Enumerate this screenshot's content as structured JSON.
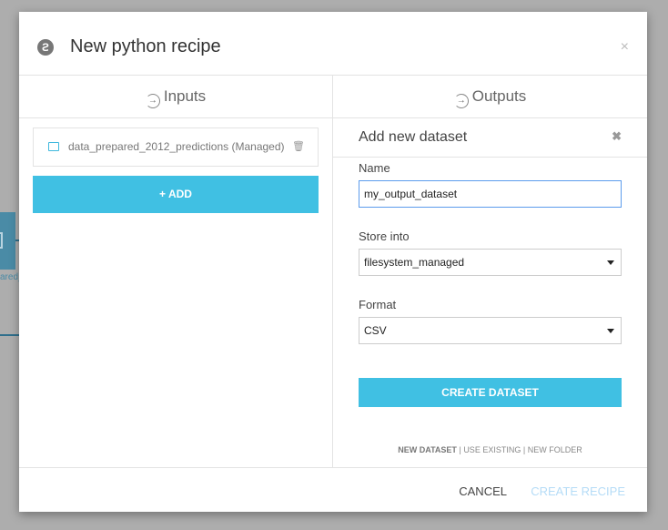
{
  "background": {
    "node_label": "ared_"
  },
  "dialog": {
    "title": "New python recipe",
    "close_icon": "×",
    "inputs": {
      "heading": "Inputs",
      "items": [
        {
          "name": "data_prepared_2012_predictions (Managed)"
        }
      ],
      "add_label": "+ ADD"
    },
    "outputs": {
      "heading": "Outputs",
      "panel_title": "Add new dataset",
      "panel_close": "✖",
      "name_label": "Name",
      "name_value": "my_output_dataset",
      "store_label": "Store into",
      "store_value": "filesystem_managed",
      "format_label": "Format",
      "format_value": "CSV",
      "create_dataset_label": "CREATE DATASET",
      "modes": {
        "new_dataset": "NEW DATASET",
        "sep": "|",
        "use_existing": "USE EXISTING",
        "new_folder": "NEW FOLDER"
      }
    },
    "footer": {
      "cancel_label": "CANCEL",
      "create_recipe_label": "CREATE RECIPE"
    }
  },
  "colors": {
    "accent": "#40c0e3",
    "disabled": "#b5dcf7",
    "focus": "#5c9ced"
  }
}
